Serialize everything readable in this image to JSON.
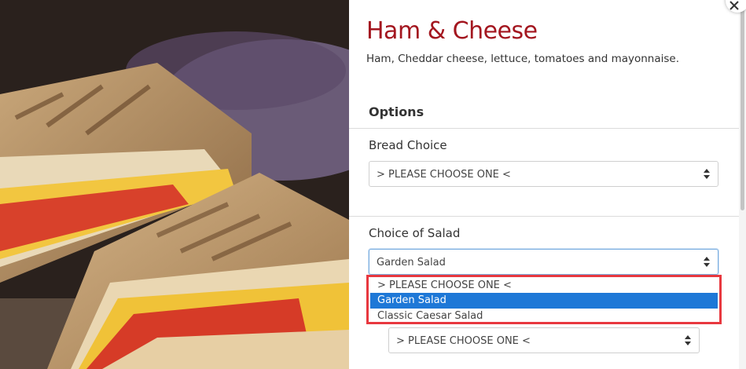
{
  "product": {
    "title": "Ham & Cheese",
    "description": "Ham, Cheddar cheese, lettuce, tomatoes and mayonnaise."
  },
  "options": {
    "heading": "Options",
    "bread": {
      "label": "Bread Choice",
      "value": "> PLEASE CHOOSE ONE <"
    },
    "salad": {
      "label": "Choice of Salad",
      "value": "Garden Salad",
      "dropdown_options": [
        "> PLEASE CHOOSE ONE <",
        "Garden Salad",
        "Classic Caesar Salad"
      ],
      "selected_index": 1
    },
    "next_select": {
      "value": "> PLEASE CHOOSE ONE <"
    }
  },
  "icons": {
    "close": "close-icon",
    "select_arrows": "select-arrows-icon"
  },
  "colors": {
    "title": "#a3161f",
    "highlight_border": "#e8383f",
    "selected_option": "#1e78d7"
  }
}
